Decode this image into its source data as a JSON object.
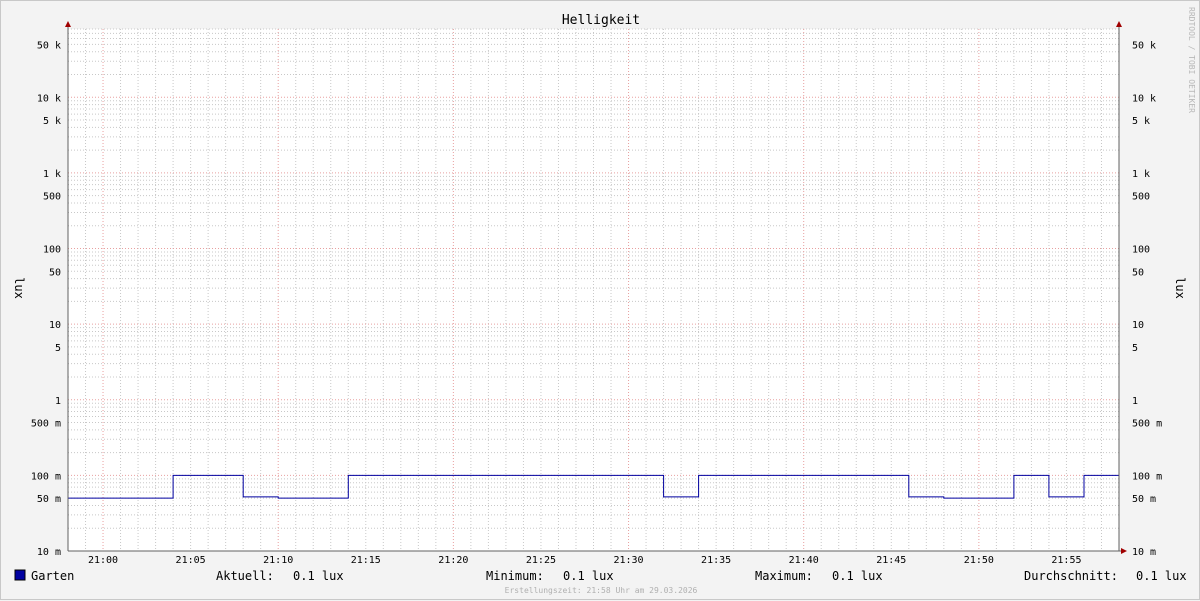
{
  "chart_data": {
    "type": "line",
    "title": "Helligkeit",
    "ylabel_left": "lux",
    "ylabel_right": "lux",
    "yscale": "log",
    "ylim": [
      0.01,
      80000
    ],
    "y_ticks": [
      {
        "value": 50000,
        "label": "50 k"
      },
      {
        "value": 10000,
        "label": "10 k"
      },
      {
        "value": 5000,
        "label": "5 k"
      },
      {
        "value": 1000,
        "label": "1 k"
      },
      {
        "value": 500,
        "label": "500"
      },
      {
        "value": 100,
        "label": "100"
      },
      {
        "value": 50,
        "label": "50"
      },
      {
        "value": 10,
        "label": "10"
      },
      {
        "value": 5,
        "label": "5"
      },
      {
        "value": 1,
        "label": "1"
      },
      {
        "value": 0.5,
        "label": "500 m"
      },
      {
        "value": 0.1,
        "label": "100 m"
      },
      {
        "value": 0.05,
        "label": "50 m"
      },
      {
        "value": 0.01,
        "label": "10 m"
      }
    ],
    "xlim": [
      "20:58",
      "21:58"
    ],
    "x_ticks": [
      "21:00",
      "21:05",
      "21:10",
      "21:15",
      "21:20",
      "21:25",
      "21:30",
      "21:35",
      "21:40",
      "21:45",
      "21:50",
      "21:55"
    ],
    "grid": true,
    "series": [
      {
        "name": "Garten",
        "color": "#0000a0",
        "points": [
          [
            "20:58",
            0.05
          ],
          [
            "21:04",
            0.05
          ],
          [
            "21:04",
            0.1
          ],
          [
            "21:08",
            0.1
          ],
          [
            "21:08",
            0.052
          ],
          [
            "21:10",
            0.052
          ],
          [
            "21:10",
            0.05
          ],
          [
            "21:14",
            0.05
          ],
          [
            "21:14",
            0.1
          ],
          [
            "21:32",
            0.1
          ],
          [
            "21:32",
            0.052
          ],
          [
            "21:34",
            0.052
          ],
          [
            "21:34",
            0.1
          ],
          [
            "21:46",
            0.1
          ],
          [
            "21:46",
            0.052
          ],
          [
            "21:48",
            0.052
          ],
          [
            "21:48",
            0.05
          ],
          [
            "21:52",
            0.05
          ],
          [
            "21:52",
            0.1
          ],
          [
            "21:54",
            0.1
          ],
          [
            "21:54",
            0.052
          ],
          [
            "21:56",
            0.052
          ],
          [
            "21:56",
            0.1
          ],
          [
            "21:58",
            0.1
          ]
        ]
      }
    ]
  },
  "legend": {
    "series_name": "Garten",
    "swatch_color": "#0000a0",
    "stats": [
      {
        "label": "Aktuell:",
        "value": "0.1 lux"
      },
      {
        "label": "Minimum:",
        "value": "0.1 lux"
      },
      {
        "label": "Maximum:",
        "value": "0.1 lux"
      },
      {
        "label": "Durchschnitt:",
        "value": "0.1 lux"
      }
    ]
  },
  "footer": "Erstellungszeit: 21:58 Uhr am 29.03.2026",
  "watermark": "RRDTOOL / TOBI OETIKER",
  "colors": {
    "canvas": "#ffffff",
    "background": "#f3f3f3",
    "major_grid": "#e8a0a0",
    "minor_grid": "#c8c8c8",
    "axis": "#606060",
    "arrow": "#a00000"
  }
}
